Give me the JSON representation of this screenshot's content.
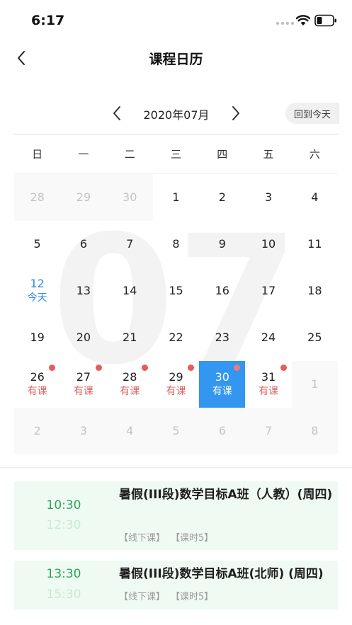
{
  "status_bar": {
    "time": "6:17"
  },
  "nav": {
    "title": "课程日历"
  },
  "calendar": {
    "month_label": "2020年07月",
    "watermark": "07",
    "today_button": "回到今天",
    "weekdays": [
      "日",
      "一",
      "二",
      "三",
      "四",
      "五",
      "六"
    ],
    "days": [
      {
        "num": "28",
        "other": true
      },
      {
        "num": "29",
        "other": true
      },
      {
        "num": "30",
        "other": true
      },
      {
        "num": "1"
      },
      {
        "num": "2"
      },
      {
        "num": "3"
      },
      {
        "num": "4"
      },
      {
        "num": "5"
      },
      {
        "num": "6"
      },
      {
        "num": "7"
      },
      {
        "num": "8"
      },
      {
        "num": "9"
      },
      {
        "num": "10"
      },
      {
        "num": "11"
      },
      {
        "num": "12",
        "today": true,
        "sub": "今天"
      },
      {
        "num": "13"
      },
      {
        "num": "14"
      },
      {
        "num": "15"
      },
      {
        "num": "16"
      },
      {
        "num": "17"
      },
      {
        "num": "18"
      },
      {
        "num": "19"
      },
      {
        "num": "20"
      },
      {
        "num": "21"
      },
      {
        "num": "22"
      },
      {
        "num": "23"
      },
      {
        "num": "24"
      },
      {
        "num": "25"
      },
      {
        "num": "26",
        "has_class": true,
        "sub": "有课"
      },
      {
        "num": "27",
        "has_class": true,
        "sub": "有课"
      },
      {
        "num": "28",
        "has_class": true,
        "sub": "有课"
      },
      {
        "num": "29",
        "has_class": true,
        "sub": "有课"
      },
      {
        "num": "30",
        "has_class": true,
        "selected": true,
        "sub": "有课"
      },
      {
        "num": "31",
        "has_class": true,
        "sub": "有课"
      },
      {
        "num": "1",
        "other": true
      },
      {
        "num": "2",
        "other": true
      },
      {
        "num": "3",
        "other": true
      },
      {
        "num": "4",
        "other": true
      },
      {
        "num": "5",
        "other": true
      },
      {
        "num": "6",
        "other": true
      },
      {
        "num": "7",
        "other": true
      },
      {
        "num": "8",
        "other": true
      }
    ]
  },
  "courses": [
    {
      "start": "10:30",
      "end": "12:30",
      "title": "暑假(III段)数学目标A班（人教）(周四)",
      "tags": [
        "【线下课】",
        "【课时5】"
      ]
    },
    {
      "start": "13:30",
      "end": "15:30",
      "title": "暑假(III段)数学目标A班(北师) (周四)",
      "tags": [
        "【线下课】",
        "【课时5】"
      ]
    }
  ],
  "colors": {
    "accent_blue": "#3396f0",
    "today_blue": "#2e8de8",
    "class_red": "#e0605e",
    "course_green": "#2fa55a",
    "card_bg": "#effaf2"
  }
}
